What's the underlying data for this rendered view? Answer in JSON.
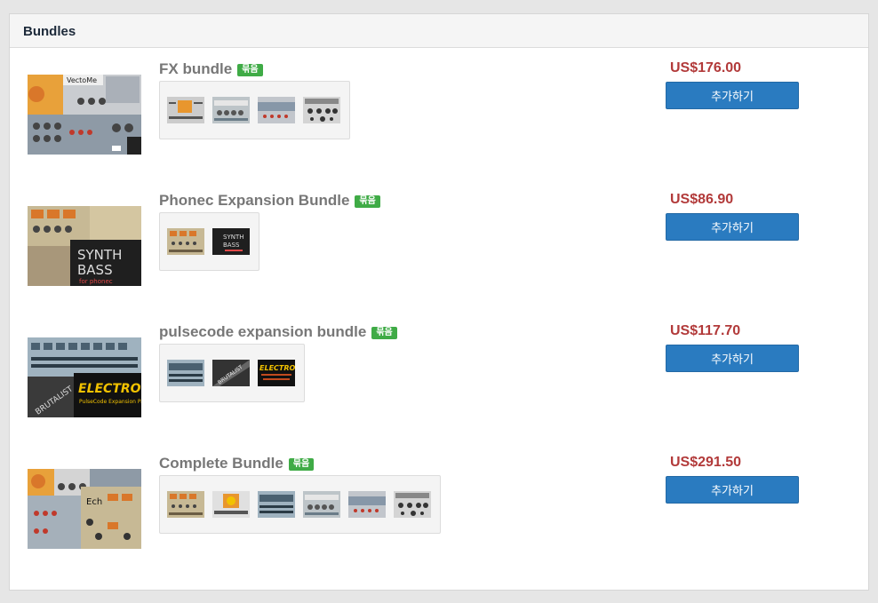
{
  "panel": {
    "title": "Bundles"
  },
  "bundles": [
    {
      "name": "FX bundle",
      "badge": "묶음",
      "price": "US$176.00",
      "button": "추가하기",
      "thumb_theme": "synth-orange",
      "items": [
        "mini-grid-orange",
        "mini-panel-gray",
        "mini-panel-red",
        "mini-knobs"
      ]
    },
    {
      "name": "Phonec Expansion Bundle",
      "badge": "묶음",
      "price": "US$86.90",
      "button": "추가하기",
      "thumb_theme": "synth-bass",
      "items": [
        "mini-grid-orange",
        "mini-synth-bass"
      ]
    },
    {
      "name": "pulsecode expansion bundle",
      "badge": "묶음",
      "price": "US$117.70",
      "button": "추가하기",
      "thumb_theme": "electro",
      "items": [
        "mini-panel-blue",
        "mini-brutalist",
        "mini-electro"
      ]
    },
    {
      "name": "Complete Bundle",
      "badge": "묶음",
      "price": "US$291.50",
      "button": "추가하기",
      "thumb_theme": "complete",
      "items": [
        "mini-grid-orange",
        "mini-sun",
        "mini-panel-blue",
        "mini-panel-gray",
        "mini-panel-red",
        "mini-knobs"
      ]
    }
  ],
  "colors": {
    "price": "#b23a3a",
    "button": "#2a7bc0",
    "badge": "#3fab46",
    "title": "#777777"
  }
}
